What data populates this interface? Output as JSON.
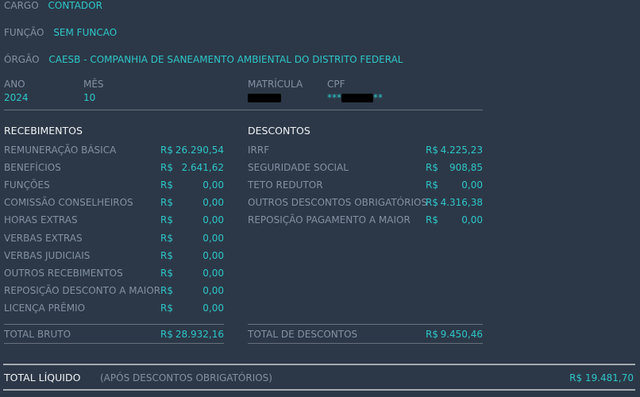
{
  "info": {
    "cargo": {
      "label": "CARGO",
      "value": "CONTADOR"
    },
    "funcao": {
      "label": "FUNÇÃO",
      "value": "SEM FUNCAO"
    },
    "orgao": {
      "label": "ÓRGÃO",
      "value": "CAESB - COMPANHIA DE SANEAMENTO AMBIENTAL DO DISTRITO FEDERAL"
    },
    "ano": {
      "label": "ANO",
      "value": "2024"
    },
    "mes": {
      "label": "MÊS",
      "value": "10"
    },
    "matricula": {
      "label": "MATRÍCULA",
      "value": "[redacted]"
    },
    "cpf": {
      "label": "CPF",
      "prefix": "***",
      "suffix": "**"
    }
  },
  "currency": "R$",
  "colors": {
    "background": "#2c3847",
    "accent": "#2ec7c9",
    "label": "#8391a3",
    "heading": "#f0f3f6"
  },
  "recebimentos": {
    "title": "RECEBIMENTOS",
    "items": [
      {
        "label": "REMUNERAÇÃO BÁSICA",
        "value": "26.290,54"
      },
      {
        "label": "BENEFÍCIOS",
        "value": "2.641,62"
      },
      {
        "label": "FUNÇÕES",
        "value": "0,00"
      },
      {
        "label": "COMISSÃO CONSELHEIROS",
        "value": "0,00"
      },
      {
        "label": "HORAS EXTRAS",
        "value": "0,00"
      },
      {
        "label": "VERBAS EXTRAS",
        "value": "0,00"
      },
      {
        "label": "VERBAS JUDICIAIS",
        "value": "0,00"
      },
      {
        "label": "OUTROS RECEBIMENTOS",
        "value": "0,00"
      },
      {
        "label": "REPOSIÇÃO DESCONTO A MAIOR",
        "value": "0,00"
      },
      {
        "label": "LICENÇA PRÊMIO",
        "value": "0,00"
      }
    ],
    "total": {
      "label": "TOTAL BRUTO",
      "value": "28.932,16"
    }
  },
  "descontos": {
    "title": "DESCONTOS",
    "items": [
      {
        "label": "IRRF",
        "value": "4.225,23"
      },
      {
        "label": "SEGURIDADE SOCIAL",
        "value": "908,85"
      },
      {
        "label": "TETO REDUTOR",
        "value": "0,00"
      },
      {
        "label": "OUTROS DESCONTOS OBRIGATÓRIOS",
        "value": "4.316,38"
      },
      {
        "label": "REPOSIÇÃO PAGAMENTO A MAIOR",
        "value": "0,00"
      }
    ],
    "total": {
      "label": "TOTAL DE DESCONTOS",
      "value": "9.450,46"
    }
  },
  "liquido": {
    "label": "TOTAL LÍQUIDO",
    "note": "(APÓS DESCONTOS OBRIGATÓRIOS)",
    "value": "R$ 19.481,70"
  }
}
